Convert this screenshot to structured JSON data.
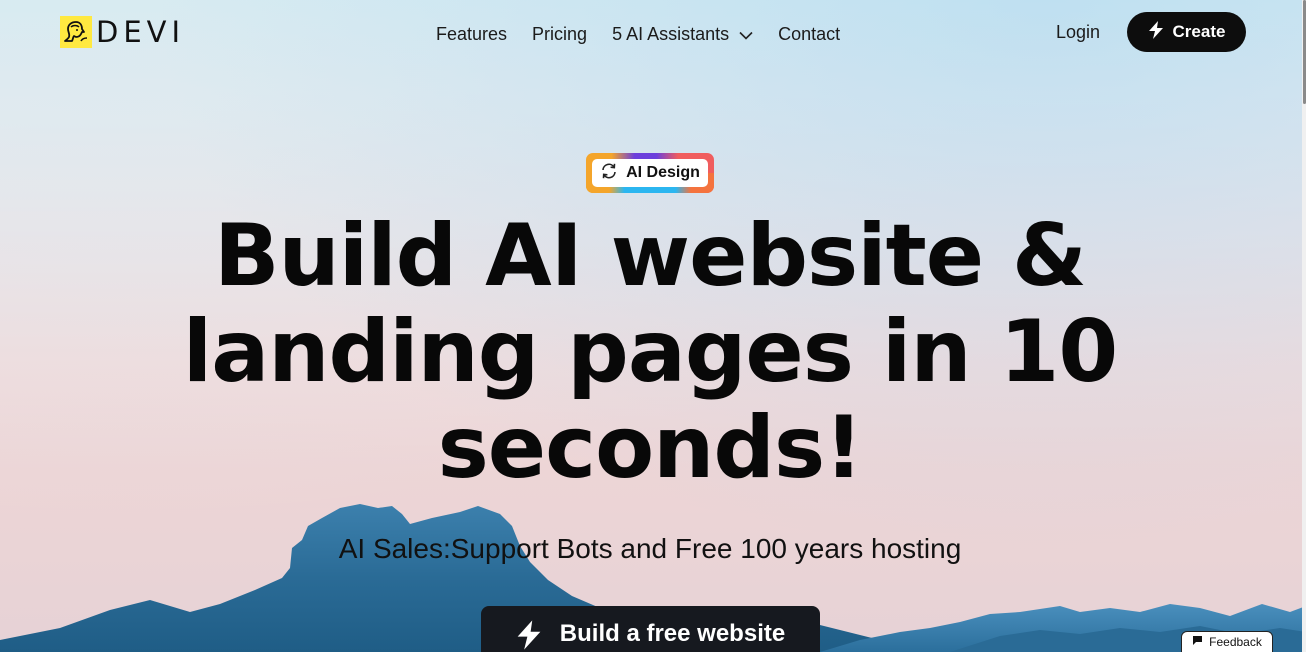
{
  "header": {
    "logo_text": "DEVI",
    "nav": [
      {
        "label": "Features"
      },
      {
        "label": "Pricing"
      },
      {
        "label": "5 AI Assistants",
        "has_dropdown": true
      },
      {
        "label": "Contact"
      }
    ],
    "login_label": "Login",
    "create_label": "Create"
  },
  "hero": {
    "badge_label": "AI Design",
    "headline_line1": "Build AI website &",
    "headline_line2": "landing pages in 10",
    "headline_line3": "seconds!",
    "subheadline": "AI Sales:Support Bots and Free 100 years hosting",
    "cta_label": "Build a free website"
  },
  "feedback_label": "Feedback",
  "colors": {
    "button_dark": "#0d0d0d",
    "logo_yellow": "#ffe940",
    "mountain_blue": "#2a6e9a",
    "badge_orange": "#f4a52b",
    "badge_purple": "#6c3fdc",
    "badge_cyan": "#2bb6f0",
    "badge_red": "#f05d5e"
  },
  "icons": {
    "logo": "woman-profile-icon",
    "create": "lightning-bolt-icon",
    "badge": "refresh-icon",
    "cta": "lightning-bolt-icon",
    "feedback": "chat-bubble-icon",
    "dropdown": "chevron-down-icon"
  }
}
